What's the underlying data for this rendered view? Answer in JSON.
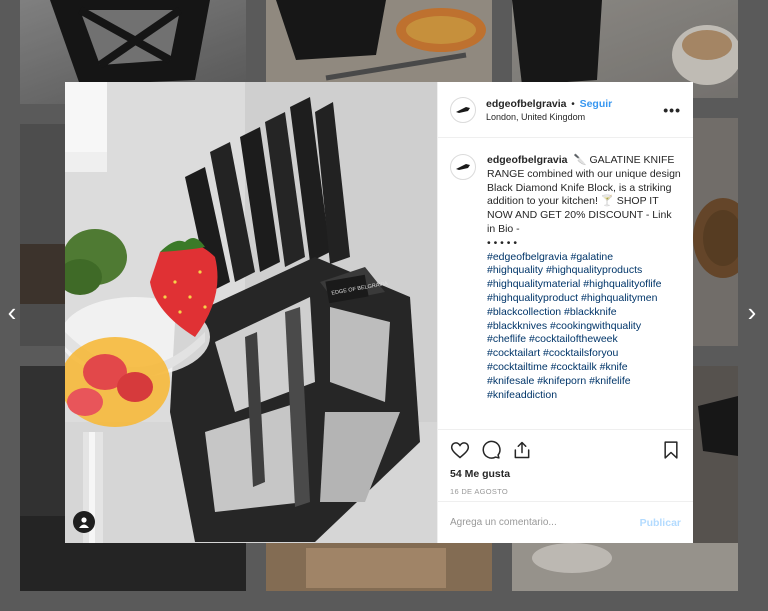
{
  "navigation": {
    "prev_arrow": "‹",
    "next_arrow": "›"
  },
  "post": {
    "username": "edgeofbelgravia",
    "follow_label": "Seguir",
    "location": "London, United Kingdom",
    "more_label": "•••",
    "caption_text": "🔪 GALATINE KNIFE RANGE combined with our unique design Black Diamond Knife Block, is a striking addition to your kitchen! 🍸 SHOP IT NOW AND GET 20% DISCOUNT - Link in Bio -",
    "caption_dots": "• • • • •",
    "hashtags": [
      "#edgeofbelgravia #galatine",
      "#highquality #highqualityproducts",
      "#highqualitymaterial #highqualityoflife",
      "#highqualityproduct #highqualitymen",
      "#blackcollection #blackknife",
      "#blackknives #cookingwithquality",
      "#cheflife #cocktailoftheweek",
      "#cocktailart #cocktailsforyou",
      "#cocktailtime #cocktailk #knife",
      "#knifesale #knifeporn #knifelife",
      "#knifeaddiction"
    ],
    "likes": "54 Me gusta",
    "date": "16 DE AGOSTO",
    "comment_placeholder": "Agrega un comentario...",
    "post_button": "Publicar",
    "logo_text": "EDGE OF BELGRAVIA"
  },
  "icons": {
    "avatar": "knife-logo-icon",
    "like": "heart-icon",
    "comment": "speech-bubble-icon",
    "share": "share-icon",
    "save": "bookmark-icon",
    "user_tag": "user-icon"
  },
  "colors": {
    "link_blue": "#3897f0",
    "hashtag": "#003569",
    "post_button_disabled": "#b3dbff",
    "knife_block": "#1f1f1f"
  }
}
